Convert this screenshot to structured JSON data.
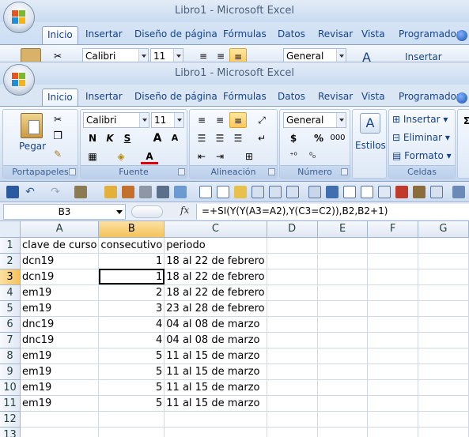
{
  "app_title": "Libro1 - Microsoft Excel",
  "tabs": [
    "Inicio",
    "Insertar",
    "Diseño de página",
    "Fórmulas",
    "Datos",
    "Revisar",
    "Vista",
    "Programador"
  ],
  "ribbon": {
    "clipboard": {
      "paste_label": "Pegar",
      "group_label": "Portapapeles"
    },
    "font": {
      "font_name": "Calibri",
      "font_size": "11",
      "bold": "N",
      "italic": "K",
      "underline": "S",
      "grow": "A",
      "shrink": "A",
      "font_color": "A",
      "group_label": "Fuente"
    },
    "alignment": {
      "group_label": "Alineación"
    },
    "number": {
      "format": "General",
      "currency": "$",
      "percent": "%",
      "thousands": "000",
      "group_label": "Número"
    },
    "styles": {
      "label": "Estilos"
    },
    "cells": {
      "insert": "Insertar",
      "delete": "Eliminar",
      "format": "Formato",
      "group_label": "Celdas"
    }
  },
  "back_window": {
    "font_name": "Calibri",
    "font_size": "11",
    "format": "General",
    "insert": "Insertar"
  },
  "formula_bar": {
    "name_box": "B3",
    "fx": "fx",
    "formula": "=+SI(Y(Y(A3=A2),Y(C3=C2)),B2,B2+1)"
  },
  "sheet": {
    "columns": [
      "A",
      "B",
      "C",
      "D",
      "E",
      "F",
      "G"
    ],
    "row_numbers": [
      "1",
      "2",
      "3",
      "4",
      "5",
      "6",
      "7",
      "8",
      "9",
      "10",
      "11",
      "12",
      "13"
    ],
    "rows": [
      [
        "clave de curso",
        "consecutivo",
        "periodo"
      ],
      [
        "dcn19",
        "1",
        "18 al 22 de febrero"
      ],
      [
        "dcn19",
        "1",
        "18 al 22 de febrero"
      ],
      [
        "em19",
        "2",
        "18 al 22 de febrero"
      ],
      [
        "em19",
        "3",
        "23 al 28 de febrero"
      ],
      [
        "dnc19",
        "4",
        "04 al 08 de marzo"
      ],
      [
        "dnc19",
        "4",
        "04 al 08 de marzo"
      ],
      [
        "em19",
        "5",
        "11 al 15 de marzo"
      ],
      [
        "em19",
        "5",
        "11 al 15 de marzo"
      ],
      [
        "em19",
        "5",
        "11 al 15 de marzo"
      ],
      [
        "em19",
        "5",
        "11 al 15 de marzo"
      ],
      [
        "",
        "",
        ""
      ],
      [
        "",
        "",
        ""
      ]
    ],
    "active_cell": "B3"
  },
  "colors": {
    "ribbon_blue": "#dbe6f4",
    "text_blue": "#15428b",
    "selected_header": "#f6c25a",
    "grid_line": "#d0d7e5"
  }
}
